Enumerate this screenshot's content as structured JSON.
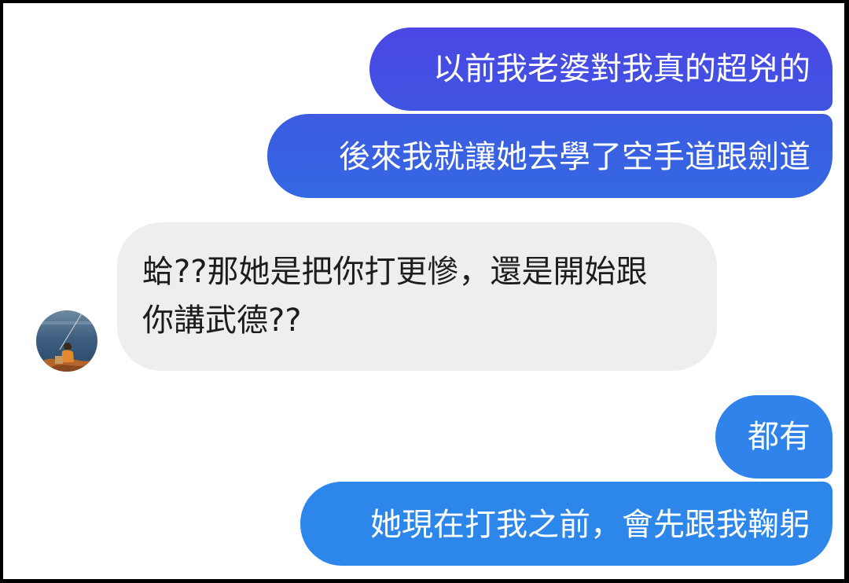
{
  "conversation": {
    "messages": [
      {
        "direction": "outgoing",
        "text": "以前我老婆對我真的超兇的"
      },
      {
        "direction": "outgoing",
        "text": "後來我就讓她去學了空手道跟劍道"
      },
      {
        "direction": "incoming",
        "lines": [
          "蛤??那她是把你打更慘，還是開始跟",
          "你講武德??"
        ]
      },
      {
        "direction": "outgoing",
        "text": "都有"
      },
      {
        "direction": "outgoing",
        "text": "她現在打我之前，會先跟我鞠躬"
      }
    ],
    "contact_avatar": {
      "icon": "fisherman-by-sea-photo"
    }
  },
  "colors": {
    "outgoing_top": "#4b47e4",
    "outgoing_bottom": "#2d87ea",
    "incoming_bg": "#eeeeee",
    "incoming_text": "#1c1c1c",
    "frame_border": "#000000"
  }
}
